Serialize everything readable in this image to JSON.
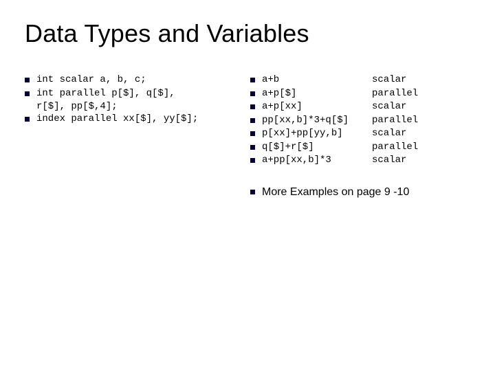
{
  "title": "Data Types and Variables",
  "left": [
    {
      "lines": [
        "int scalar a, b, c;"
      ]
    },
    {
      "lines": [
        "int parallel p[$], q[$],",
        "r[$], pp[$,4];"
      ]
    },
    {
      "lines": [
        "index parallel xx[$], yy[$];"
      ]
    }
  ],
  "right": [
    {
      "expr": "a+b",
      "kind": "scalar"
    },
    {
      "expr": "a+p[$]",
      "kind": "parallel"
    },
    {
      "expr": "a+p[xx]",
      "kind": "scalar"
    },
    {
      "expr": "pp[xx,b]*3+q[$]",
      "kind": "parallel"
    },
    {
      "expr": "p[xx]+pp[yy,b]",
      "kind": "scalar"
    },
    {
      "expr": "q[$]+r[$]",
      "kind": "parallel"
    },
    {
      "expr": "a+pp[xx,b]*3",
      "kind": "scalar"
    }
  ],
  "more": "More Examples on page 9 -10"
}
